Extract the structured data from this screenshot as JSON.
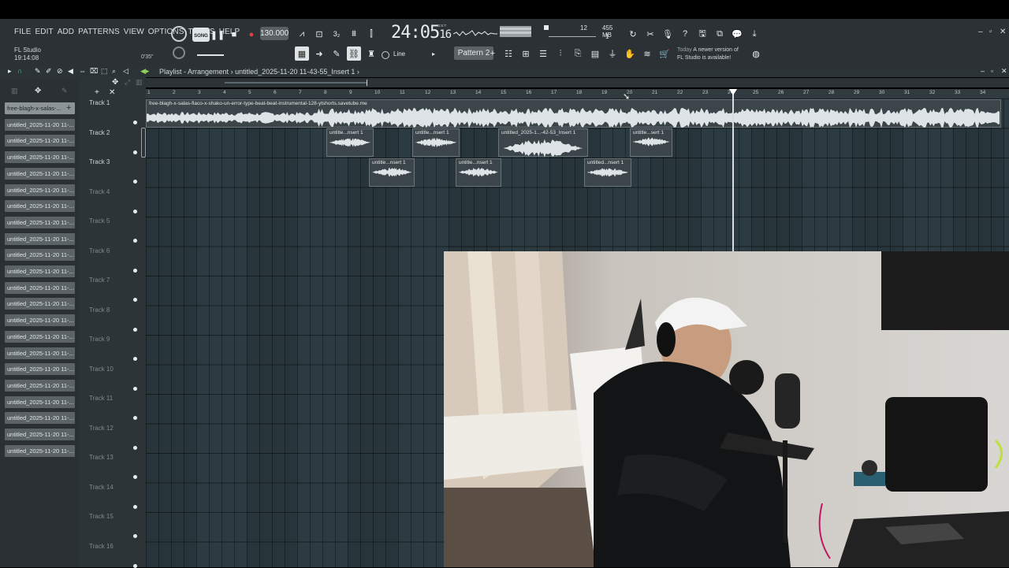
{
  "menus": [
    "FILE",
    "EDIT",
    "ADD",
    "PATTERNS",
    "VIEW",
    "OPTIONS",
    "TOOLS",
    "HELP"
  ],
  "app": {
    "name": "FL Studio",
    "clock": "19:14:08",
    "pos": "0'35\""
  },
  "transport": {
    "song_label": "SONG",
    "tempo": "130.000",
    "time_main": "24:05",
    "time_sub": "16",
    "time_sup": "B:S:T"
  },
  "cpu": {
    "voices": "12",
    "mem": "455 MB",
    "cores": "1"
  },
  "hint": {
    "day": "Today",
    "text1": "A newer version of",
    "text2": "FL Studio is available!"
  },
  "tools": {
    "snap": "Line",
    "pattern": "Pattern 2"
  },
  "playlist": {
    "title": "Playlist - Arrangement",
    "sep": "›",
    "file": "untitled_2025-11-20 11-43-55_Insert 1",
    "sep2": "›"
  },
  "clip_list": [
    "free-blagh-x-salas-...",
    "untitled_2025-11-20 11-...",
    "untitled_2025-11-20 11-...",
    "untitled_2025-11-20 11-...",
    "untitled_2025-11-20 11-...",
    "untitled_2025-11-20 11-...",
    "untitled_2025-11-20 11-...",
    "untitled_2025-11-20 11-...",
    "untitled_2025-11-20 11-...",
    "untitled_2025-11-20 11-...",
    "untitled_2025-11-20 11-...",
    "untitled_2025-11-20 11-...",
    "untitled_2025-11-20 11-...",
    "untitled_2025-11-20 11-...",
    "untitled_2025-11-20 11-...",
    "untitled_2025-11-20 11-...",
    "untitled_2025-11-20 11-...",
    "untitled_2025-11-20 11-...",
    "untitled_2025-11-20 11-...",
    "untitled_2025-11-20 11-...",
    "untitled_2025-11-20 11-...",
    "untitled_2025-11-20 11-..."
  ],
  "tracks": [
    "Track 1",
    "Track 2",
    "Track 3",
    "Track 4",
    "Track 5",
    "Track 6",
    "Track 7",
    "Track 8",
    "Track 9",
    "Track 10",
    "Track 11",
    "Track 12",
    "Track 13",
    "Track 14",
    "Track 15",
    "Track 16"
  ],
  "ruler": [
    "1",
    "2",
    "3",
    "4",
    "5",
    "6",
    "7",
    "8",
    "9",
    "10",
    "11",
    "12",
    "13",
    "14",
    "15",
    "16",
    "17",
    "18",
    "19",
    "20",
    "21",
    "22",
    "23",
    "24",
    "25",
    "26",
    "27",
    "28",
    "29",
    "30",
    "31",
    "32",
    "33",
    "34"
  ],
  "clips": {
    "beat": "free-blagh-x-salas-flaco-x-shako-un-error-type-beat-beat-instrumental-128-ytshorts.savetube.me",
    "t2a": "untitle...nsert 1",
    "t2b": "untitle...nsert 1",
    "t2c": "untitled_2025-1...-42-53_Insert 1",
    "t2d": "untitle...sert 1",
    "t3a": "untitle...nsert 1",
    "t3b": "untitle...nsert 1",
    "t3c": "untitled...nsert 1"
  }
}
